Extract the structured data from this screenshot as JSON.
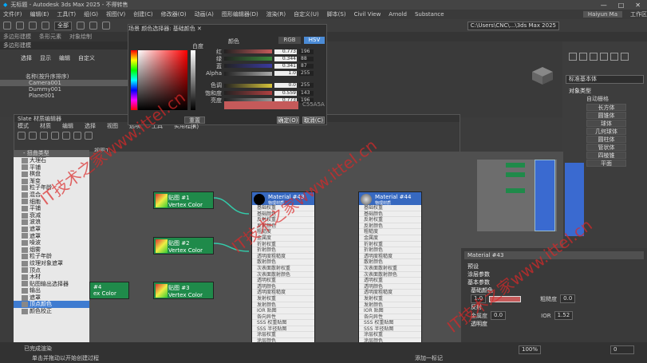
{
  "titlebar": {
    "title": "无标题 - Autodesk 3ds Max 2025 - 不得转售",
    "controls": [
      "—",
      "□",
      "✕"
    ]
  },
  "menubar": {
    "items": [
      "文件(F)",
      "编辑(E)",
      "工具(T)",
      "组(G)",
      "视图(V)",
      "创建(C)",
      "修改器(O)",
      "动画(A)",
      "图形编辑器(D)",
      "渲染(R)",
      "自定义(U)",
      "脚本(S)",
      "Civil View",
      "Arnold",
      "Substance"
    ],
    "user": "Haiyun Ma",
    "workspace": "工作区"
  },
  "toolbar": {
    "dropdown": "全部",
    "path": "C:\\Users\\CNC\\...\\3ds Max 2025"
  },
  "ribbon": {
    "items": [
      "多边形建模",
      "条形元素",
      "对象绘制"
    ],
    "sub": "多边形建模"
  },
  "scene_explorer": {
    "tabs": [
      "选择",
      "显示",
      "编辑",
      "自定义"
    ],
    "header": "名称(按升序排序)",
    "objects": [
      "Camera001",
      "Dummy001",
      "Plane001"
    ]
  },
  "picker": {
    "title": "场景 颜色选择器: 基础颜色",
    "whiteness": "白度",
    "blackness": "黑度",
    "hue_label": "颜色",
    "rgb_btn": "RGB",
    "hsv_btn": "HSV",
    "channels": [
      {
        "label": "红",
        "val": "0.773",
        "v2": "196",
        "color": "#c55a5a"
      },
      {
        "label": "绿",
        "val": "0.344",
        "v2": "88",
        "color": "#3a8a3a"
      },
      {
        "label": "蓝",
        "val": "0.341",
        "v2": "87",
        "color": "#3a3aa0"
      },
      {
        "label": "Alpha",
        "val": "1.0",
        "v2": "255",
        "color": "#aaaaaa"
      },
      {
        "label": "色调",
        "val": "0.0",
        "v2": "255",
        "color": "#d6c33a"
      },
      {
        "label": "饱和度",
        "val": "0.559",
        "v2": "143",
        "color": "#b04040"
      },
      {
        "label": "亮度",
        "val": "0.773",
        "v2": "196",
        "color": "#999999"
      }
    ],
    "hex": "C55A5A",
    "reset": "重置(R)",
    "ok": "确定(O)",
    "cancel": "取消(C)"
  },
  "slate": {
    "title": "Slate 材质编辑器",
    "menus": [
      "模式",
      "材质",
      "编辑",
      "选择",
      "视图",
      "选项",
      "工具",
      "实用程序"
    ],
    "view_label": "视图1"
  },
  "browser": {
    "title": "- 扭曲类型",
    "items": [
      "大理石",
      "平铺",
      "棋盘",
      "渐变",
      "粒子年龄",
      "混合",
      "细胞",
      "平铺",
      "衰减",
      "波浪",
      "遮罩",
      "遮罩",
      "噪波",
      "烟雾",
      "粒子年龄",
      "纹理对象遮罩",
      "顶点",
      "木材",
      "贴图输出选择器",
      "输出",
      "遮罩",
      "顶点颜色",
      "颜色校正"
    ],
    "selected": 21
  },
  "nodes": {
    "vc": [
      {
        "title": "贴图 #1",
        "sub": "Vertex Color"
      },
      {
        "title": "贴图 #2",
        "sub": "Vertex Color"
      },
      {
        "title": "贴图 #3",
        "sub": "Vertex Color"
      },
      {
        "title": "#4",
        "sub": "ex Color"
      }
    ],
    "mat1": {
      "title": "Material #43",
      "sub": "物理材质",
      "rows": [
        "基础权重",
        "基础颜色",
        "反射权重",
        "反射颜色",
        "粗糙度",
        "金属度",
        "折射权重",
        "折射颜色",
        "透明度粗糙度",
        "散射颜色",
        "次表面散射权重",
        "次表面散射颜色",
        "透明权重",
        "透明颜色",
        "透明度粗糙度",
        "发射权重",
        "发射颜色",
        "IOR 贴图",
        "各向异性",
        "SSS 权重贴图",
        "SSS 半径贴图",
        "涂层权重",
        "涂层颜色",
        "涂层粗糙度",
        "涂层IOR"
      ]
    },
    "mat2": {
      "title": "Material #44",
      "sub": "物理材质",
      "rows": [
        "基础权重",
        "基础颜色",
        "反射权重",
        "反射颜色",
        "粗糙度",
        "金属度",
        "折射权重",
        "折射颜色",
        "透明度粗糙度",
        "散射颜色",
        "次表面散射权重",
        "次表面散射颜色",
        "透明权重",
        "透明颜色",
        "透明度粗糙度",
        "发射权重",
        "发射颜色",
        "IOR 贴图",
        "各向异性",
        "SSS 权重贴图",
        "SSS 半径贴图",
        "涂层权重",
        "涂层颜色",
        "涂层粗糙度"
      ]
    }
  },
  "matpanel": {
    "header": "Material #43",
    "sections": [
      "预设",
      "涂层参数",
      "基本参数"
    ],
    "base_color": "基础颜色",
    "roughness": "粗糙度",
    "roughness_val": "0.0",
    "weight": "1.0",
    "reflect": "反射",
    "metal": "金属度",
    "metal_val": "0.0",
    "ior": "IOR",
    "ior_val": "1.52",
    "transparency": "透明度"
  },
  "rightpanel": {
    "title": "标准基本体",
    "header": "对象类型",
    "items": [
      "自动栅格",
      "长方体",
      "圆锥体",
      "球体",
      "几何球体",
      "圆柱体",
      "管状体",
      "四棱锥",
      "平面"
    ]
  },
  "status": {
    "left1": "已完成渲染",
    "left2": "单击并拖动以开始创建过程",
    "zoom": "100%",
    "add_marker": "添加一标记",
    "frames": "0",
    "watermark": "IT技术之家www.ittel.cn"
  }
}
